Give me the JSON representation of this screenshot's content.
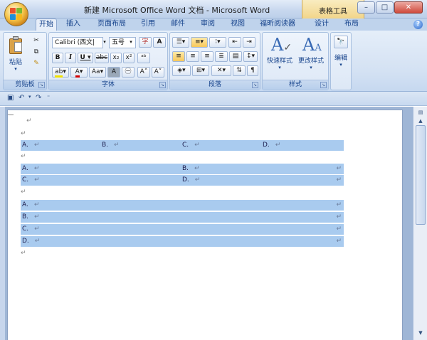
{
  "window": {
    "title": "新建 Microsoft Office Word 文档 - Microsoft Word",
    "context_tab": "表格工具",
    "min": "–",
    "max": "□",
    "close": "✕"
  },
  "tabs": [
    "开始",
    "插入",
    "页面布局",
    "引用",
    "邮件",
    "审阅",
    "视图",
    "福昕阅读器",
    "设计",
    "布局"
  ],
  "ribbon": {
    "clipboard": {
      "paste": "粘贴",
      "label": "剪贴板"
    },
    "font": {
      "font_name": "Calibri (西文|",
      "font_size": "五号",
      "label": "字体"
    },
    "paragraph": {
      "label": "段落"
    },
    "styles": {
      "quick_styles": "快速样式",
      "change_styles": "更改样式",
      "label": "样式"
    },
    "editing": {
      "label": "编辑"
    }
  },
  "document": {
    "para_mark": "↵",
    "table1": [
      [
        {
          "letter": "A."
        },
        {
          "letter": "B."
        },
        {
          "letter": "C."
        },
        {
          "letter": "D."
        }
      ]
    ],
    "table2": [
      [
        {
          "letter": "A."
        },
        {
          "letter": "B."
        }
      ],
      [
        {
          "letter": "C."
        },
        {
          "letter": "D."
        }
      ]
    ],
    "table3": [
      [
        {
          "letter": "A."
        }
      ],
      [
        {
          "letter": "B."
        }
      ],
      [
        {
          "letter": "C."
        }
      ],
      [
        {
          "letter": "D."
        }
      ]
    ]
  },
  "colors": {
    "row_highlight": "#a9cbef",
    "ribbon_bg": "#d3e1f3"
  }
}
